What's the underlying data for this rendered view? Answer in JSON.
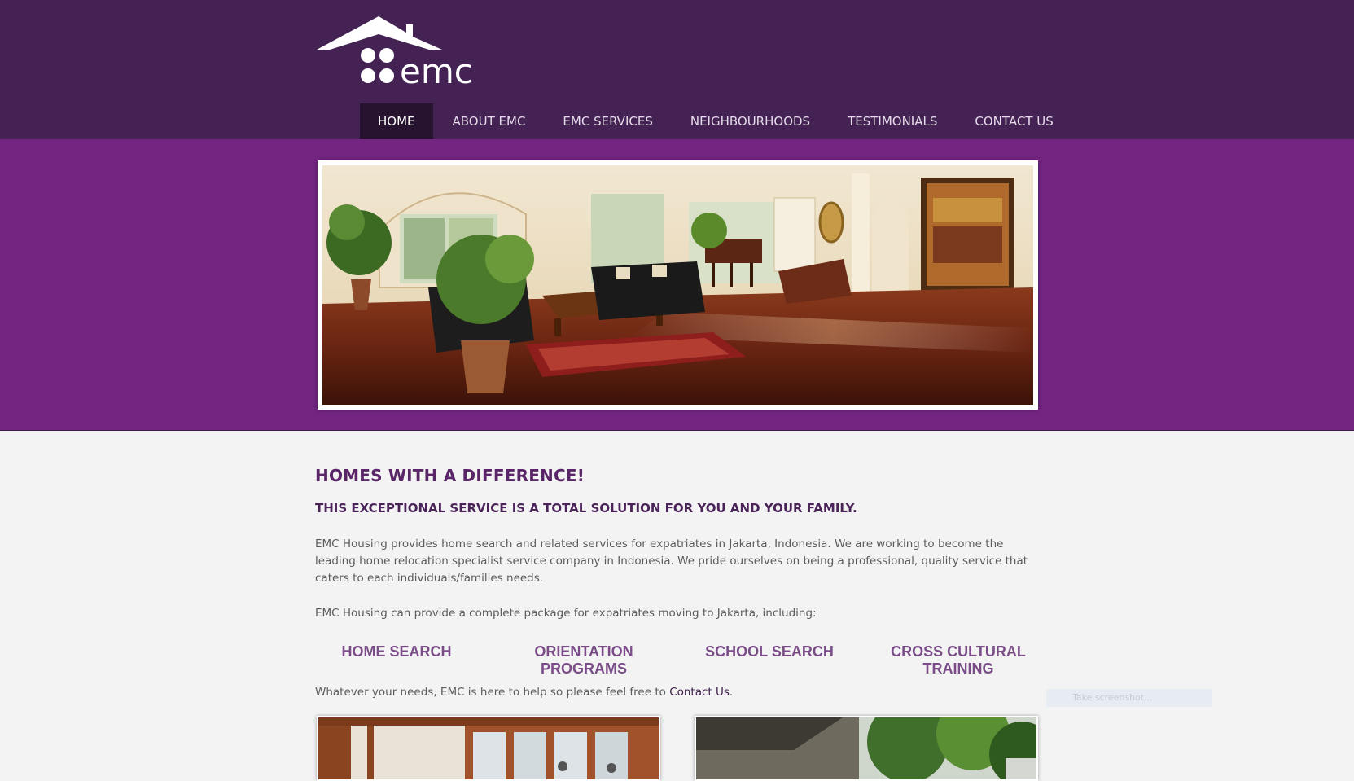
{
  "brand": {
    "logo_text": "emc"
  },
  "nav": {
    "items": [
      {
        "label": "HOME",
        "active": true
      },
      {
        "label": "ABOUT EMC",
        "active": false
      },
      {
        "label": "EMC SERVICES",
        "active": false
      },
      {
        "label": "NEIGHBOURHOODS",
        "active": false
      },
      {
        "label": "TESTIMONIALS",
        "active": false
      },
      {
        "label": "CONTACT US",
        "active": false
      }
    ]
  },
  "main": {
    "heading": "HOMES WITH A DIFFERENCE!",
    "subheading": "THIS EXCEPTIONAL SERVICE IS A TOTAL SOLUTION FOR YOU AND YOUR FAMILY.",
    "paragraph1": "EMC Housing provides home search and related services for expatriates in Jakarta, Indonesia. We are working to become the leading home relocation specialist service company in Indonesia. We pride ourselves on being a professional, quality service that caters to each individuals/families needs.",
    "paragraph2": "EMC Housing can provide a complete package for expatriates moving to Jakarta, including:",
    "services": [
      {
        "line1": "HOME SEARCH",
        "line2": ""
      },
      {
        "line1": "ORIENTATION",
        "line2": "PROGRAMS"
      },
      {
        "line1": "SCHOOL SEARCH",
        "line2": ""
      },
      {
        "line1": "CROSS CULTURAL",
        "line2": "TRAINING"
      }
    ],
    "closing_prefix": "Whatever your needs, EMC is here to help so please feel free to ",
    "closing_link": "Contact Us",
    "closing_suffix": "."
  },
  "overlay": {
    "screenshot_placeholder": "Take screenshot..."
  },
  "colors": {
    "header_bg": "#442354",
    "hero_bg": "#742582",
    "nav_active_bg": "#271230",
    "heading": "#5a2468",
    "service_heading": "#7a4d88"
  }
}
